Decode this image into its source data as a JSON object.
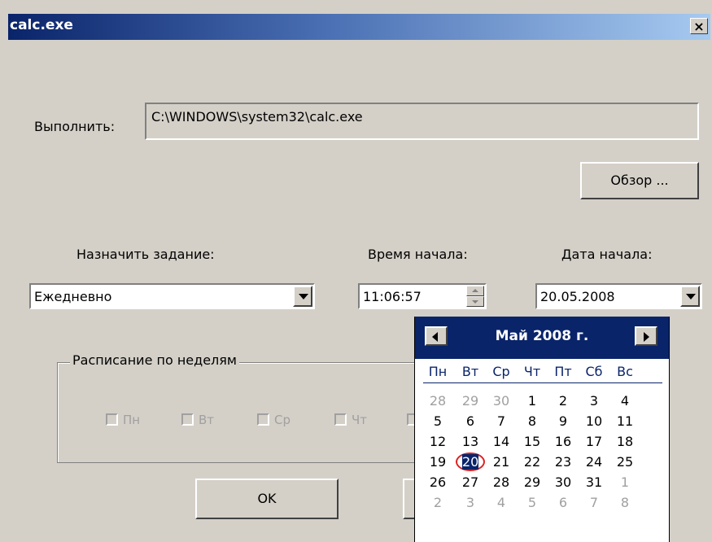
{
  "window": {
    "title": "calc.exe",
    "close_glyph": "×"
  },
  "run": {
    "label": "Выполнить:",
    "value": "C:\\WINDOWS\\system32\\calc.exe"
  },
  "browse_button": "Обзор ...",
  "schedule": {
    "label": "Назначить задание:",
    "value": "Ежедневно"
  },
  "start_time": {
    "label": "Время начала:",
    "value": "11:06:57"
  },
  "start_date": {
    "label": "Дата начала:",
    "value": "20.05.2008"
  },
  "weekly": {
    "title": "Расписание по неделям",
    "days": [
      "Пн",
      "Вт",
      "Ср",
      "Чт"
    ]
  },
  "ok_button": "OK",
  "calendar": {
    "month_label": "Май 2008 г.",
    "weekdays": [
      "Пн",
      "Вт",
      "Ср",
      "Чт",
      "Пт",
      "Сб",
      "Вс"
    ],
    "weeks": [
      [
        "28",
        "29",
        "30",
        "1",
        "2",
        "3",
        "4"
      ],
      [
        "5",
        "6",
        "7",
        "8",
        "9",
        "10",
        "11"
      ],
      [
        "12",
        "13",
        "14",
        "15",
        "16",
        "17",
        "18"
      ],
      [
        "19",
        "20",
        "21",
        "22",
        "23",
        "24",
        "25"
      ],
      [
        "26",
        "27",
        "28",
        "29",
        "30",
        "31",
        "1"
      ],
      [
        "2",
        "3",
        "4",
        "5",
        "6",
        "7",
        "8"
      ]
    ],
    "other_month": [
      [
        true,
        true,
        true,
        false,
        false,
        false,
        false
      ],
      [
        false,
        false,
        false,
        false,
        false,
        false,
        false
      ],
      [
        false,
        false,
        false,
        false,
        false,
        false,
        false
      ],
      [
        false,
        false,
        false,
        false,
        false,
        false,
        false
      ],
      [
        false,
        false,
        false,
        false,
        false,
        false,
        true
      ],
      [
        true,
        true,
        true,
        true,
        true,
        true,
        true
      ]
    ],
    "selected_day": "20"
  }
}
